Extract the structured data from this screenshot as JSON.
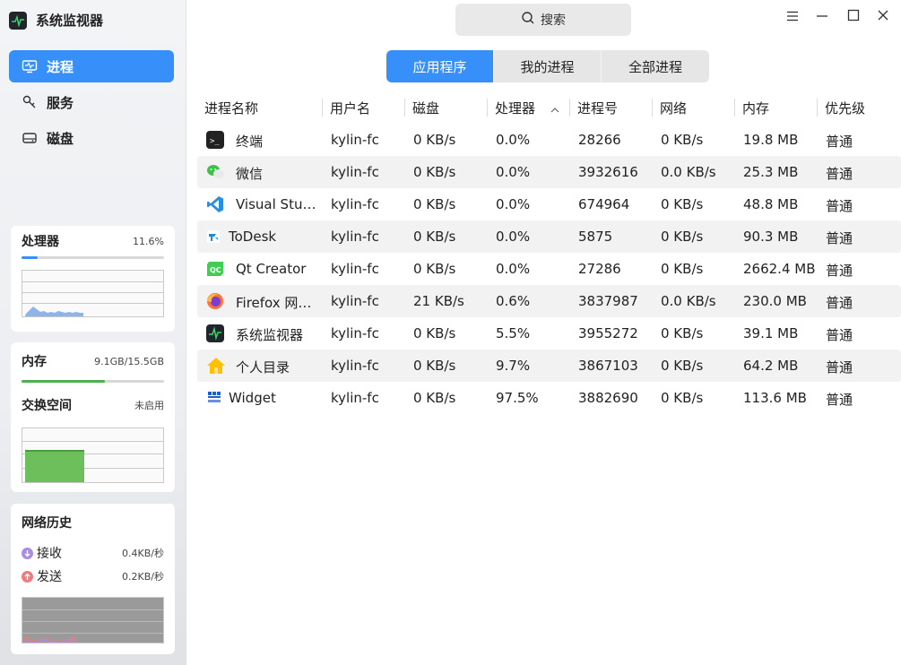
{
  "app": {
    "title": "系统监视器"
  },
  "nav": [
    {
      "label": "进程",
      "icon": "monitor-icon",
      "active": true
    },
    {
      "label": "服务",
      "icon": "service-icon",
      "active": false
    },
    {
      "label": "磁盘",
      "icon": "disk-icon",
      "active": false
    }
  ],
  "cpu": {
    "label": "处理器",
    "value": "11.6%",
    "percent": 11.6
  },
  "memory": {
    "label": "内存",
    "value": "9.1GB/15.5GB",
    "percent": 58.7
  },
  "swap": {
    "label": "交换空间",
    "value": "未启用"
  },
  "network": {
    "title": "网络历史",
    "receive_label": "接收",
    "receive_value": "0.4KB/秒",
    "send_label": "发送",
    "send_value": "0.2KB/秒"
  },
  "search": {
    "placeholder": "搜索"
  },
  "tabs": [
    {
      "label": "应用程序",
      "active": true
    },
    {
      "label": "我的进程",
      "active": false
    },
    {
      "label": "全部进程",
      "active": false
    }
  ],
  "columns": [
    "进程名称",
    "用户名",
    "磁盘",
    "处理器",
    "进程号",
    "网络",
    "内存",
    "优先级"
  ],
  "rows": [
    {
      "icon": "terminal-icon",
      "name": "终端",
      "user": "kylin-fc",
      "disk": "0 KB/s",
      "cpu": "0.0%",
      "pid": "28266",
      "net": "0 KB/s",
      "mem": "19.8 MB",
      "prio": "普通"
    },
    {
      "icon": "wechat-icon",
      "name": "微信",
      "user": "kylin-fc",
      "disk": "0 KB/s",
      "cpu": "0.0%",
      "pid": "3932616",
      "net": "0.0 KB/s",
      "mem": "25.3 MB",
      "prio": "普通"
    },
    {
      "icon": "vscode-icon",
      "name": "Visual Stu…",
      "user": "kylin-fc",
      "disk": "0 KB/s",
      "cpu": "0.0%",
      "pid": "674964",
      "net": "0 KB/s",
      "mem": "48.8 MB",
      "prio": "普通"
    },
    {
      "icon": "todesk-icon",
      "name": "ToDesk",
      "user": "kylin-fc",
      "disk": "0 KB/s",
      "cpu": "0.0%",
      "pid": "5875",
      "net": "0 KB/s",
      "mem": "90.3 MB",
      "prio": "普通"
    },
    {
      "icon": "qtcreator-icon",
      "name": "Qt Creator",
      "user": "kylin-fc",
      "disk": "0 KB/s",
      "cpu": "0.0%",
      "pid": "27286",
      "net": "0 KB/s",
      "mem": "2662.4 MB",
      "prio": "普通"
    },
    {
      "icon": "firefox-icon",
      "name": "Firefox 网…",
      "user": "kylin-fc",
      "disk": "21 KB/s",
      "cpu": "0.6%",
      "pid": "3837987",
      "net": "0.0 KB/s",
      "mem": "230.0 MB",
      "prio": "普通"
    },
    {
      "icon": "system-monitor-icon",
      "name": "系统监视器",
      "user": "kylin-fc",
      "disk": "0 KB/s",
      "cpu": "5.5%",
      "pid": "3955272",
      "net": "0 KB/s",
      "mem": "39.1 MB",
      "prio": "普通"
    },
    {
      "icon": "home-folder-icon",
      "name": "个人目录",
      "user": "kylin-fc",
      "disk": "0 KB/s",
      "cpu": "9.7%",
      "pid": "3867103",
      "net": "0 KB/s",
      "mem": "64.2 MB",
      "prio": "普通"
    },
    {
      "icon": "widget-icon",
      "name": "Widget",
      "user": "kylin-fc",
      "disk": "0 KB/s",
      "cpu": "97.5%",
      "pid": "3882690",
      "net": "0 KB/s",
      "mem": "113.6 MB",
      "prio": "普通"
    }
  ],
  "colors": {
    "accent": "#3790fa",
    "memory_bar": "#4caf50",
    "receive": "#a98ce6",
    "send": "#f07b7b"
  }
}
